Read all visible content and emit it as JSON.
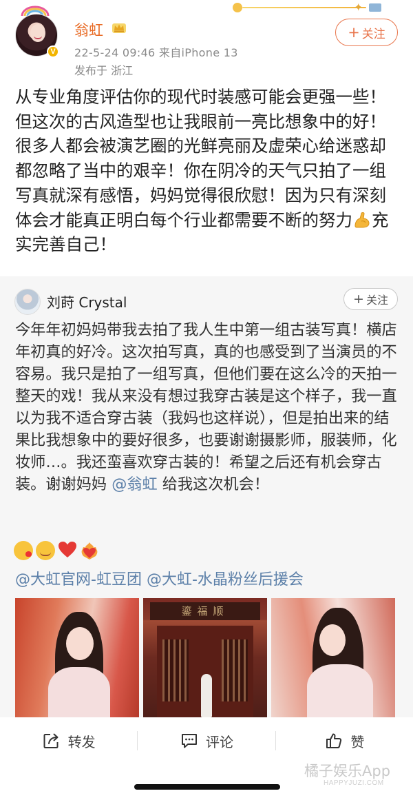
{
  "post": {
    "author": "翁虹",
    "time_source": "22-5-24 09:46  来自iPhone 13",
    "location": "发布于 浙江",
    "follow_plus": "+",
    "follow_label": "关注",
    "text_before_icon": "从专业角度评估你的现代时装感可能会更强一些！但这次的古风造型也让我眼前一亮比想象中的好！很多人都会被演艺圈的光鲜亮丽及虚荣心给迷惑却都忽略了当中的艰辛！你在阴冷的天气只拍了一组写真就深有感悟，妈妈觉得很欣慰！因为只有深刻体会才能真正明白每个行业都需要不断的努力",
    "text_after_icon": "充实完善自己！",
    "inline_icon": "flexed-biceps-icon"
  },
  "quote": {
    "author": "刘莳 Crystal",
    "follow_plus": "+",
    "follow_label": "关注",
    "text": "今年年初妈妈带我去拍了我人生中第一组古装写真！横店年初真的好冷。这次拍写真，真的也感受到了当演员的不容易。我只是拍了一组写真，但他们要在这么冷的天拍一整天的戏！我从来没有想过我穿古装是这个样子，我一直以为我不适合穿古装（我妈也这样说），但是拍出来的结果比我想象中的要好很多，也要谢谢摄影师，服装师，化妆师…。我还蛮喜欢穿古装的！希望之后还有机会穿古装。谢谢妈妈 ",
    "mention": "@翁虹",
    "text_end": " 给我这次机会！",
    "emojis": [
      "kissing-face-icon",
      "smiling-face-with-hearts-icon",
      "red-heart-icon",
      "heart-on-fire-icon"
    ],
    "tag1": "@大虹官网-虹豆团",
    "tag2": "@大虹-水晶粉丝后援会",
    "photo_sign": "鎏福顺"
  },
  "actions": {
    "repost": "转发",
    "comment": "评论",
    "like": "赞"
  },
  "watermark": {
    "main": "橘子娱乐App",
    "sub": "HAPPYJUZI.COM"
  },
  "colors": {
    "author": "#e86a24",
    "follow": "#e8744a",
    "link": "#5b7fa8",
    "quote_bg": "#f6f6f6"
  }
}
